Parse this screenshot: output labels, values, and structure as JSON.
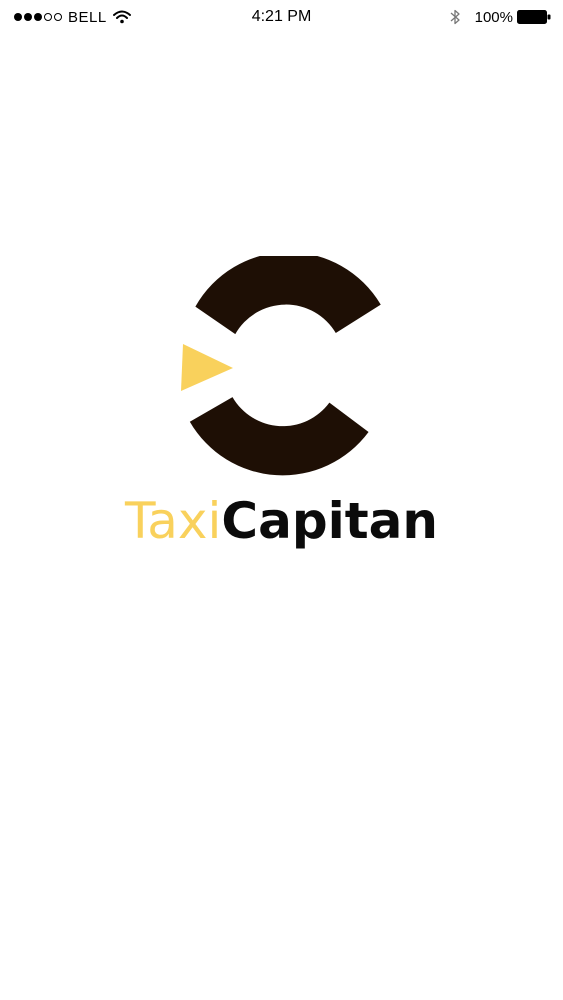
{
  "status_bar": {
    "signal_bars_filled": 3,
    "signal_bars_total": 5,
    "carrier": "BELL",
    "time": "4:21 PM",
    "battery_percent": "100%",
    "icons": [
      "wifi-icon",
      "bluetooth-icon",
      "battery-icon"
    ]
  },
  "logo": {
    "icon": "taxi-capitan-logo-icon",
    "brand_part_1": "Taxi",
    "brand_part_2": "Capitan",
    "colors": {
      "primary_dark": "#1E0F05",
      "accent_yellow": "#F9D15C",
      "text_dark": "#0b0b0b"
    }
  }
}
